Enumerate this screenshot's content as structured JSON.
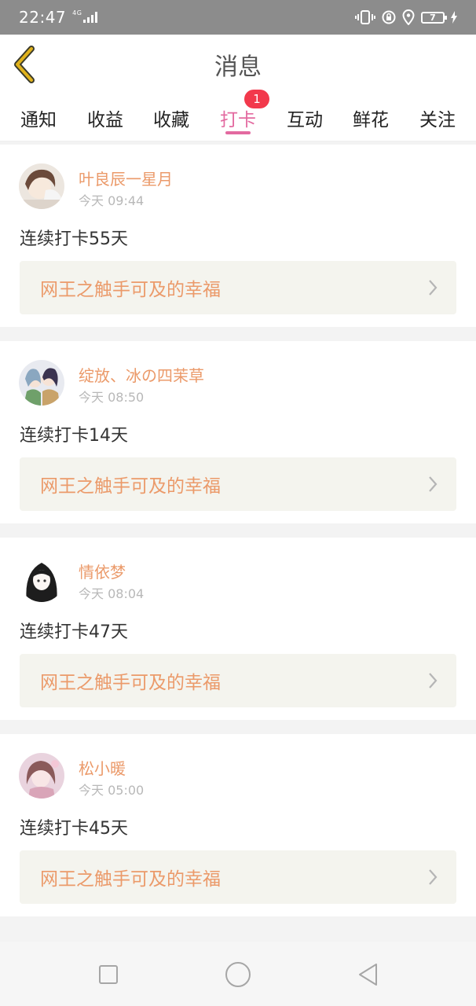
{
  "status_bar": {
    "time": "22:47",
    "network": "4G",
    "battery": "7",
    "icons": [
      "vibrate-icon",
      "alarm-icon",
      "location-icon",
      "charging-icon"
    ]
  },
  "header": {
    "title": "消息",
    "back_icon": "chevron-left-icon"
  },
  "tabs": [
    {
      "label": "通知"
    },
    {
      "label": "收益"
    },
    {
      "label": "收藏"
    },
    {
      "label": "打卡",
      "active": true,
      "badge": "1"
    },
    {
      "label": "互动"
    },
    {
      "label": "鲜花"
    },
    {
      "label": "关注"
    }
  ],
  "feed": [
    {
      "user": "叶良辰一星月",
      "time": "今天 09:44",
      "text": "连续打卡55天",
      "book": "网王之触手可及的幸福"
    },
    {
      "user": "绽放、冰の四茉草",
      "time": "今天 08:50",
      "text": "连续打卡14天",
      "book": "网王之触手可及的幸福"
    },
    {
      "user": "情依梦",
      "time": "今天 08:04",
      "text": "连续打卡47天",
      "book": "网王之触手可及的幸福"
    },
    {
      "user": "松小暖",
      "time": "今天 05:00",
      "text": "连续打卡45天",
      "book": "网王之触手可及的幸福"
    }
  ],
  "colors": {
    "accent": "#e36aa0",
    "username": "#eb9a6a",
    "badge": "#f2394c",
    "back_icon": "#e0b21c"
  },
  "nav_bar": {
    "icons": [
      "recent-apps-icon",
      "home-icon",
      "back-icon"
    ]
  }
}
